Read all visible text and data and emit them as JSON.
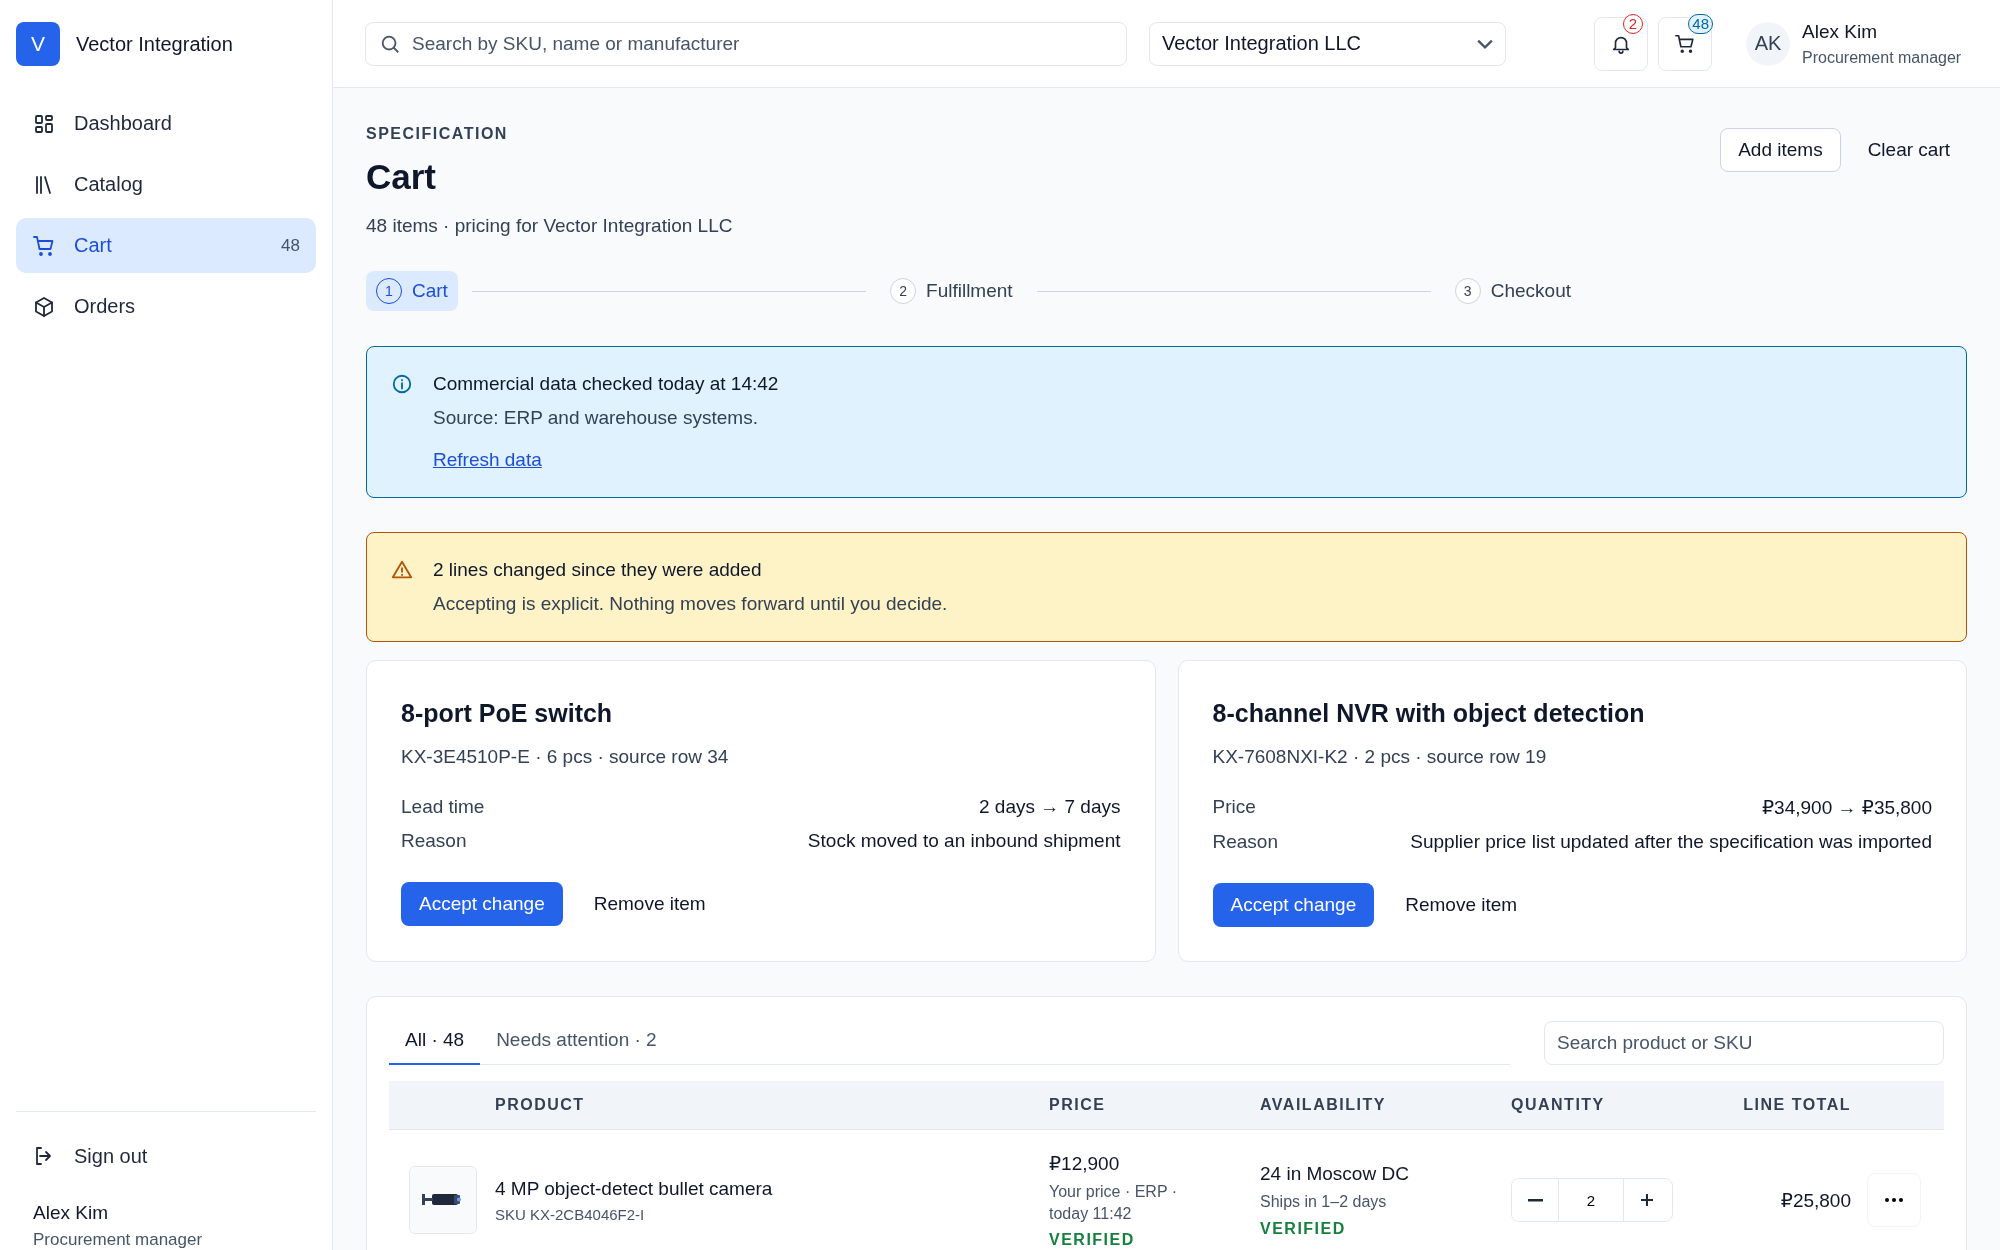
{
  "brand": {
    "logo": "V",
    "name": "Vector Integration"
  },
  "sidebar": {
    "items": [
      {
        "label": "Dashboard",
        "selected": false
      },
      {
        "label": "Catalog",
        "selected": false
      },
      {
        "label": "Cart",
        "selected": true,
        "count": "48"
      },
      {
        "label": "Orders",
        "selected": false
      }
    ],
    "sign_out": "Sign out",
    "user": {
      "name": "Alex Kim",
      "role": "Procurement manager"
    }
  },
  "topbar": {
    "search": {
      "placeholder": "Search by SKU, name or manufacturer"
    },
    "company": "Vector Integration LLC",
    "notifications": "2",
    "cart_count": "48",
    "user": {
      "initials": "AK",
      "name": "Alex Kim",
      "role": "Procurement manager"
    }
  },
  "header": {
    "eyebrow": "SPECIFICATION",
    "title": "Cart",
    "subtitle": "48 items · pricing for Vector Integration LLC",
    "buttons": [
      "Add items",
      "Clear cart"
    ]
  },
  "steps": [
    {
      "number": "1",
      "label": "Cart",
      "selected": true
    },
    {
      "number": "2",
      "label": "Fulfillment",
      "selected": false
    },
    {
      "number": "3",
      "label": "Checkout",
      "selected": false
    }
  ],
  "info": {
    "title": "Commercial data checked today at 14:42",
    "text": "Source: ERP and warehouse systems.",
    "link": "Refresh data"
  },
  "warning": {
    "title": "2 lines changed since they were added",
    "text": "Accepting is explicit. Nothing moves forward until you decide."
  },
  "changes": [
    {
      "title": "8-port PoE switch",
      "meta": "KX-3E4510P-E · 6 pcs · source row 34",
      "rows": [
        {
          "label": "Lead time",
          "value": "2 days → 7 days"
        },
        {
          "label": "Reason",
          "value": "Stock moved to an inbound shipment"
        }
      ],
      "accept": "Accept change",
      "remove": "Remove item"
    },
    {
      "title": "8-channel NVR with object detection",
      "meta": "KX-7608NXI-K2 · 2 pcs · source row 19",
      "rows": [
        {
          "label": "Price",
          "value": "₽34,900 → ₽35,800"
        },
        {
          "label": "Reason",
          "value": "Supplier price list updated after the specification was imported"
        }
      ],
      "accept": "Accept change",
      "remove": "Remove item"
    }
  ],
  "table": {
    "tabs": [
      {
        "label": "All · 48",
        "selected": true
      },
      {
        "label": "Needs attention · 2",
        "selected": false
      }
    ],
    "search": {
      "placeholder": "Search product or SKU"
    },
    "columns": [
      "PRODUCT",
      "PRICE",
      "AVAILABILITY",
      "QUANTITY",
      "LINE TOTAL"
    ],
    "rows": [
      {
        "kind": "picture",
        "name": "4 MP object-detect bullet camera",
        "sku": "SKU KX-2CB4046F2-I",
        "price": "₽12,900",
        "price_note": "Your price · ERP · today 11:42",
        "price_status": "VERIFIED",
        "availability": "24 in Moscow DC",
        "shipping": "Ships in 1–2 days",
        "availability_status": "VERIFIED",
        "quantity": "2",
        "line_total": "₽25,800"
      }
    ]
  }
}
